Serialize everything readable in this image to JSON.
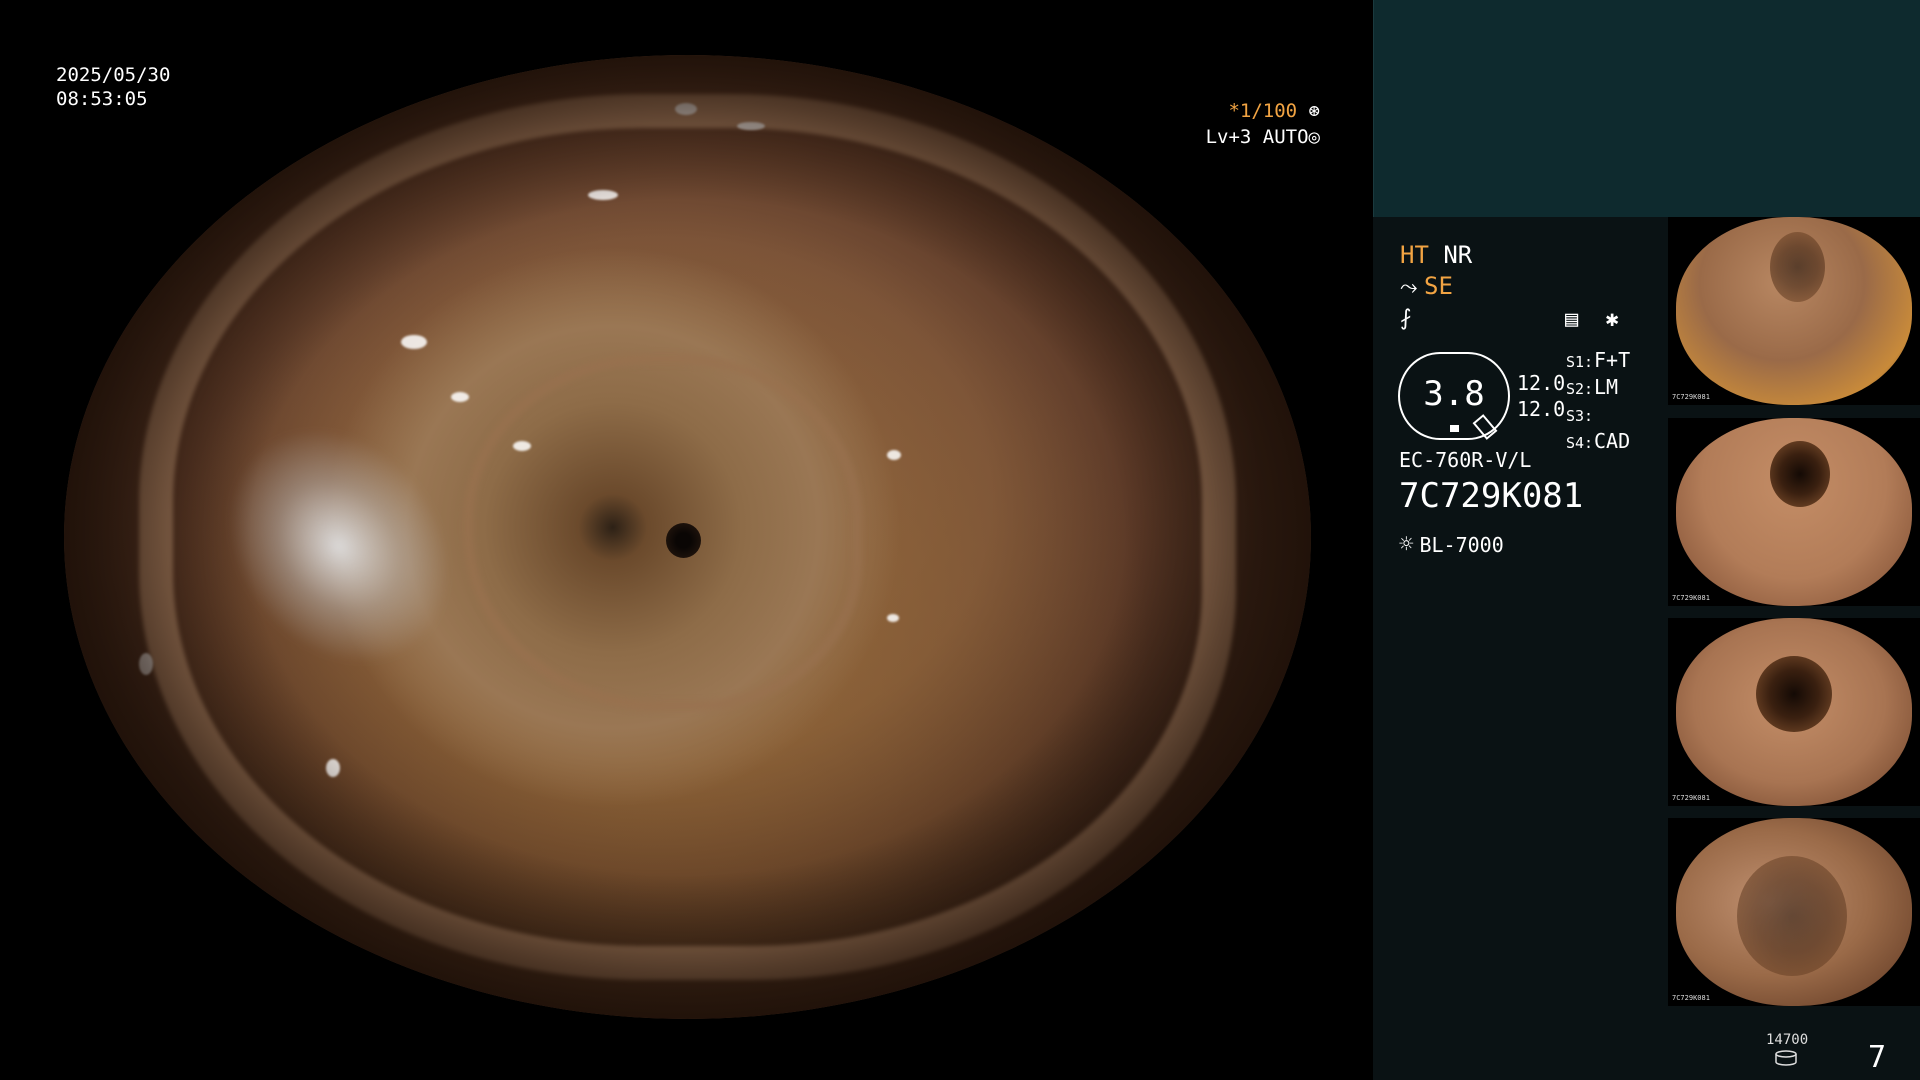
{
  "overlay": {
    "date": "2025/05/30",
    "time": "08:53:05",
    "shutter_speed": "*1/100",
    "shutter_icon": "aperture-icon",
    "level": "Lv+3",
    "exposure_mode": "AUTO",
    "exposure_icon": "iris-icon"
  },
  "panel": {
    "image_modes": {
      "ht": "HT",
      "nr": "NR",
      "se": "SE"
    },
    "gauge": {
      "value": "3.8",
      "upper": "12.0",
      "lower": "12.0"
    },
    "switches": [
      {
        "key": "S1:",
        "value": "F+T"
      },
      {
        "key": "S2:",
        "value": "LM"
      },
      {
        "key": "S3:",
        "value": ""
      },
      {
        "key": "S4:",
        "value": "CAD"
      }
    ],
    "scope_model": "EC-760R-V/L",
    "scope_serial": "7C729K081",
    "light_source": "BL-7000",
    "thumbnails": [
      {
        "tag": "7C729K081"
      },
      {
        "tag": "7C729K081"
      },
      {
        "tag": "7C729K081"
      },
      {
        "tag": "7C729K081"
      }
    ],
    "storage_count": "14700",
    "image_count": "7"
  },
  "colors": {
    "accent_orange": "#f2a443",
    "panel_bg": "#0a1214",
    "panel_top_bg": "#0e2a2e"
  }
}
